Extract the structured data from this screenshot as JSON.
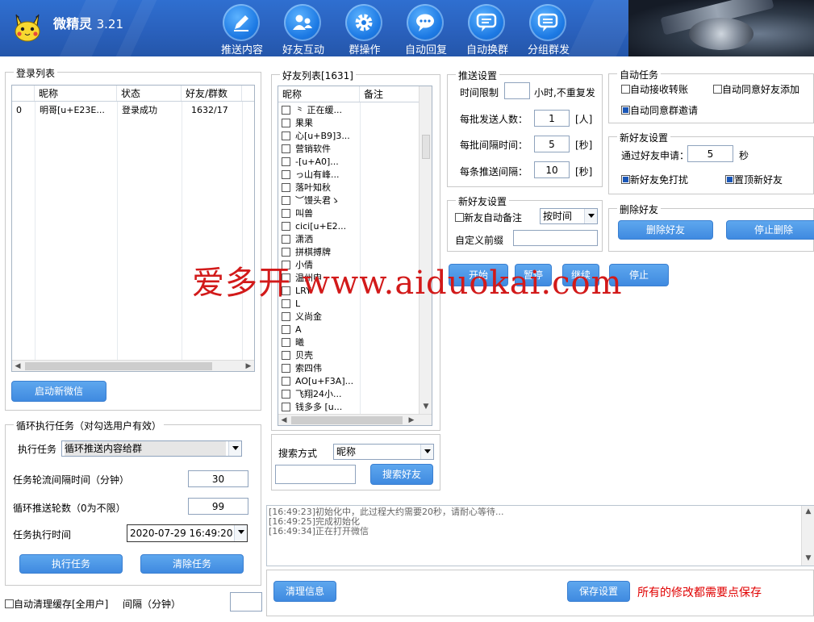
{
  "app": {
    "name": "微精灵",
    "version": "3.21"
  },
  "toolbar": [
    {
      "id": "push",
      "label": "推送内容",
      "icon": "pen-icon"
    },
    {
      "id": "friend",
      "label": "好友互动",
      "icon": "friends-icon"
    },
    {
      "id": "group",
      "label": "群操作",
      "icon": "gear-icon"
    },
    {
      "id": "reply",
      "label": "自动回复",
      "icon": "chat-icon"
    },
    {
      "id": "switch",
      "label": "自动换群",
      "icon": "chat-switch-icon"
    },
    {
      "id": "grouppost",
      "label": "分组群发",
      "icon": "chat-group-icon"
    }
  ],
  "login": {
    "title": "登录列表",
    "columns": [
      "昵称",
      "状态",
      "好友/群数"
    ],
    "rows": [
      {
        "index": "0",
        "nickname": "明哥[u+E23E...",
        "status": "登录成功",
        "counts": "1632/17"
      }
    ],
    "start_button": "启动新微信"
  },
  "loop": {
    "title": "循环执行任务（对勾选用户有效）",
    "exec_task_label": "执行任务",
    "exec_task_value": "循环推送内容给群",
    "interval_label": "任务轮流间隔时间（分钟）",
    "interval_value": "30",
    "rounds_label": "循环推送轮数（0为不限）",
    "rounds_value": "99",
    "time_label": "任务执行时间",
    "time_value": "2020-07-29 16:49:20",
    "run_button": "执行任务",
    "clear_button": "清除任务"
  },
  "cache": {
    "label": "自动清理缓存[全用户]",
    "interval_label": "间隔（分钟）",
    "interval_value": ""
  },
  "friends": {
    "title": "好友列表[1631]",
    "columns": [
      "昵称",
      "备注"
    ],
    "items": [
      "⺀ 正在缓...",
      "果果",
      "心[u+B9]3...",
      "营销软件",
      "  -[u+A0]...",
      "っ山有峰...",
      "落叶知秋",
      "︶馒头君ゝ",
      "叫兽",
      "cici[u+E2...",
      "潇洒",
      "拼棋搏牌",
      "小倩",
      "温州申",
      "LRY",
      "L",
      "义尚金",
      "A",
      "曦",
      "贝壳",
      "索四伟",
      "AO[u+F3A]...",
      "飞翔24小...",
      "钱多多 [u..."
    ],
    "search_label": "搜索方式",
    "search_mode": "昵称",
    "search_value": "",
    "search_button": "搜索好友"
  },
  "push_settings": {
    "title": "推送设置",
    "time_limit_label": "时间限制",
    "time_limit_value": "",
    "time_limit_suffix": "小时,不重复发",
    "batch_label": "每批发送人数：",
    "batch_value": "1",
    "batch_unit": "[人]",
    "batch_interval_label": "每批间隔时间：",
    "batch_interval_value": "5",
    "batch_interval_unit": "[秒]",
    "each_interval_label": "每条推送间隔：",
    "each_interval_value": "10",
    "each_interval_unit": "[秒]"
  },
  "new_friend_left": {
    "title": "新好友设置",
    "auto_remark_label": "新友自动备注",
    "auto_remark_checked": false,
    "remark_mode": "按时间",
    "prefix_label": "自定义前缀",
    "prefix_value": ""
  },
  "controls": {
    "start": "开始",
    "pause": "暂停",
    "resume": "继续",
    "stop": "停止"
  },
  "auto_tasks": {
    "title": "自动任务",
    "accept_transfer": {
      "label": "自动接收转账",
      "checked": false
    },
    "accept_friend": {
      "label": "自动同意好友添加",
      "checked": false
    },
    "accept_group": {
      "label": "自动同意群邀请",
      "checked": true
    }
  },
  "new_friend_right": {
    "title": "新好友设置",
    "apply_label": "通过好友申请：",
    "apply_value": "5",
    "apply_unit": "秒",
    "dnd": {
      "label": "新好友免打扰",
      "checked": true
    },
    "pin": {
      "label": "置顶新好友",
      "checked": true
    }
  },
  "delete_friends": {
    "title": "删除好友",
    "delete_button": "删除好友",
    "stop_button": "停止删除"
  },
  "log": {
    "lines": [
      "[16:49:23]初始化中，此过程大约需要20秒，请耐心等待...",
      "[16:49:25]完成初始化",
      "[16:49:34]正在打开微信"
    ]
  },
  "bottom": {
    "clear_button": "清理信息",
    "save_button": "保存设置",
    "save_hint": "所有的修改都需要点保存"
  },
  "watermark": "爱多开 www.aiduokai.com",
  "colors": {
    "header": "#2a61bd",
    "button": "#4a94e6",
    "hint": "#e00000",
    "watermark": "#d21a1a"
  }
}
